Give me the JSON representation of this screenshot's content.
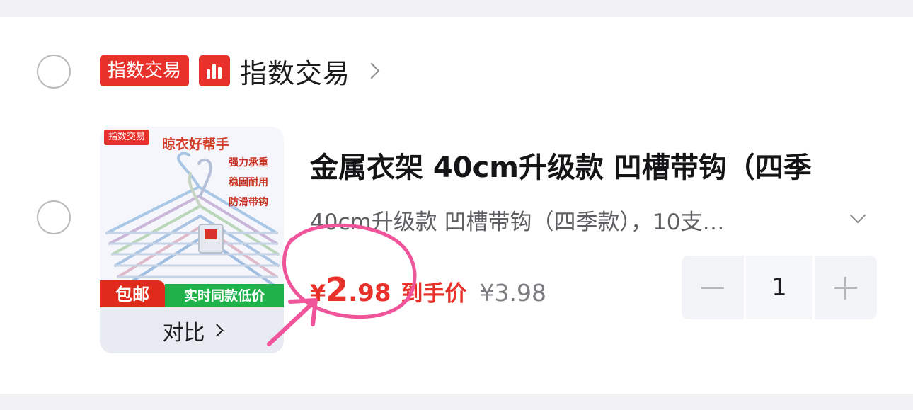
{
  "shop": {
    "badge": "指数交易",
    "name": "指数交易",
    "logo_icon": "bar-chart-icon",
    "chevron_icon": "chevron-right-icon"
  },
  "product": {
    "thumbnail": {
      "tag": "指数交易",
      "headline": "晾衣好帮手",
      "features": [
        "强力承重",
        "稳固耐用",
        "防滑带钩"
      ],
      "free_shipping": "包邮",
      "low_price_badge": "实时同款低价",
      "compare_label": "对比",
      "compare_chevron": "chevron-right-icon"
    },
    "title": "金属衣架 40cm升级款 凹槽带钩（四季",
    "spec": "40cm升级款 凹槽带钩（四季款），10支…",
    "spec_chevron": "chevron-down-icon",
    "price": {
      "currency": "¥",
      "integer": "2",
      "decimal": ".98",
      "label": "到手价",
      "original": "¥3.98"
    },
    "quantity": {
      "value": "1",
      "minus_icon": "minus-icon",
      "plus_icon": "plus-icon"
    }
  },
  "colors": {
    "accent_red": "#e8312a",
    "annotation_pink": "#f0549a",
    "green_badge": "#1fb24a",
    "background": "#f2f2f4"
  }
}
